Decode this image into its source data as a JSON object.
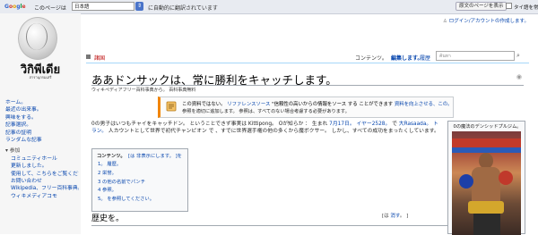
{
  "translate_bar": {
    "google": "Google",
    "page_label": "このページは",
    "language": "日本語",
    "message": "に自動的に翻訳されています",
    "show_original": "原文のページを表示",
    "checkbox_label": "□ タイ語を常に翻訳"
  },
  "sidebar": {
    "wordmark": "วิกิพีเดีย",
    "tagline": "สารานุกรมเสรี",
    "nav": [
      "ホーム。",
      "最近の出来事。",
      "興味をする。",
      "記事選択。",
      "記事の証明",
      "ランダムな記事"
    ],
    "section_header": "▾ 参加",
    "section_items": [
      "コミュニティホール",
      "更新しました。",
      "使用して、こちらをご覧ください。",
      "お問い合わせ",
      "Wikipedia、フリー百科事典。",
      "ウィキメディアコモ"
    ]
  },
  "user_links": "ログイン/アカウントの作成します。",
  "tabs": {
    "article": "諸国",
    "contents": "コンテンツ。",
    "edit": "編集します。",
    "history": "履歴",
    "search_placeholder": "ค้นหา"
  },
  "article": {
    "title": "ああドンサックは、常に勝利をキャッチします。",
    "from": "ウィキペディアフリー百科事典から。 百科事典無料",
    "notice_line1_a": "この資料ではない。",
    "notice_line1_link1": "リファレンスソース",
    "notice_line1_b": "\"信頼性の高いからの情報をソース する ことができます",
    "notice_line1_link2": "資料を向上させる、この。",
    "notice_line2": "参照を適切に追加します。 参照は、すべてのない場合考慮する必要があります。",
    "para_a": "0の男子はいつもチャイをキャッチドン。 ということできず事実は Kittipong。 Oが知らか ： 生まれ",
    "para_link1": "7月17日。",
    "para_link2": "イヤー2528。",
    "para_b": "で",
    "para_link3": "大Rasaada。",
    "para_link4": "トラン。",
    "para_c": "人カウントとして世界で初代チャンピオン で 、すでに世界選手権の他の多くから魔ボクサー。 しかし、すべての成功をまったくしています。",
    "toc_title": "コンテンツ。",
    "toc_hide": "[は 非表示にします。 ]を",
    "toc_items": [
      "1。 履歴。",
      "2 栄誉。",
      "3 の他の名前でパンチ",
      "4 参照。",
      "5。 を参照してください。"
    ],
    "section_title": "歴史を。",
    "section_edit_pre": "[は ",
    "section_edit_link": "消す",
    "section_edit_post": "。 ]",
    "infobox_caption": "0の魔法のデンシッドプルジム。"
  }
}
